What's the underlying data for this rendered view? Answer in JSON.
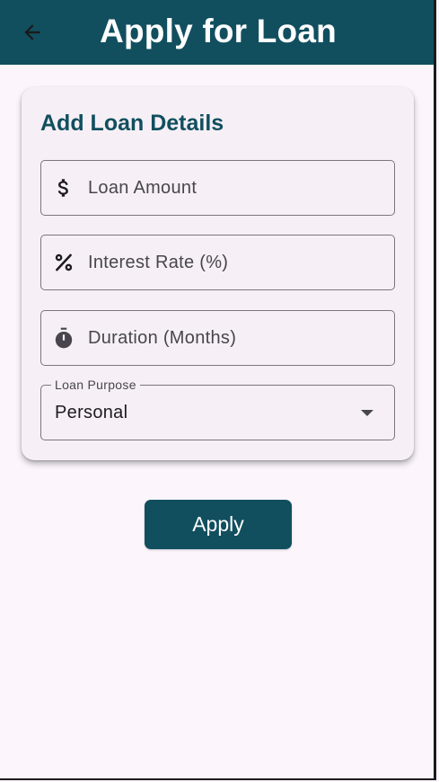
{
  "app_bar": {
    "title": "Apply for Loan",
    "back_icon": "arrow-back-icon",
    "background": "#114f5f"
  },
  "card": {
    "title": "Add Loan Details",
    "fields": [
      {
        "icon": "dollar-icon",
        "placeholder": "Loan Amount",
        "value": ""
      },
      {
        "icon": "percent-icon",
        "placeholder": "Interest Rate (%)",
        "value": ""
      },
      {
        "icon": "timer-icon",
        "placeholder": "Duration (Months)",
        "value": ""
      }
    ],
    "purpose": {
      "label": "Loan Purpose",
      "selected": "Personal",
      "icon": "caret-down-icon"
    }
  },
  "apply_button": {
    "label": "Apply"
  },
  "colors": {
    "accent": "#114f5f",
    "background": "#fcf6fc",
    "card": "#f6f0f6",
    "outline": "#7a757f"
  }
}
